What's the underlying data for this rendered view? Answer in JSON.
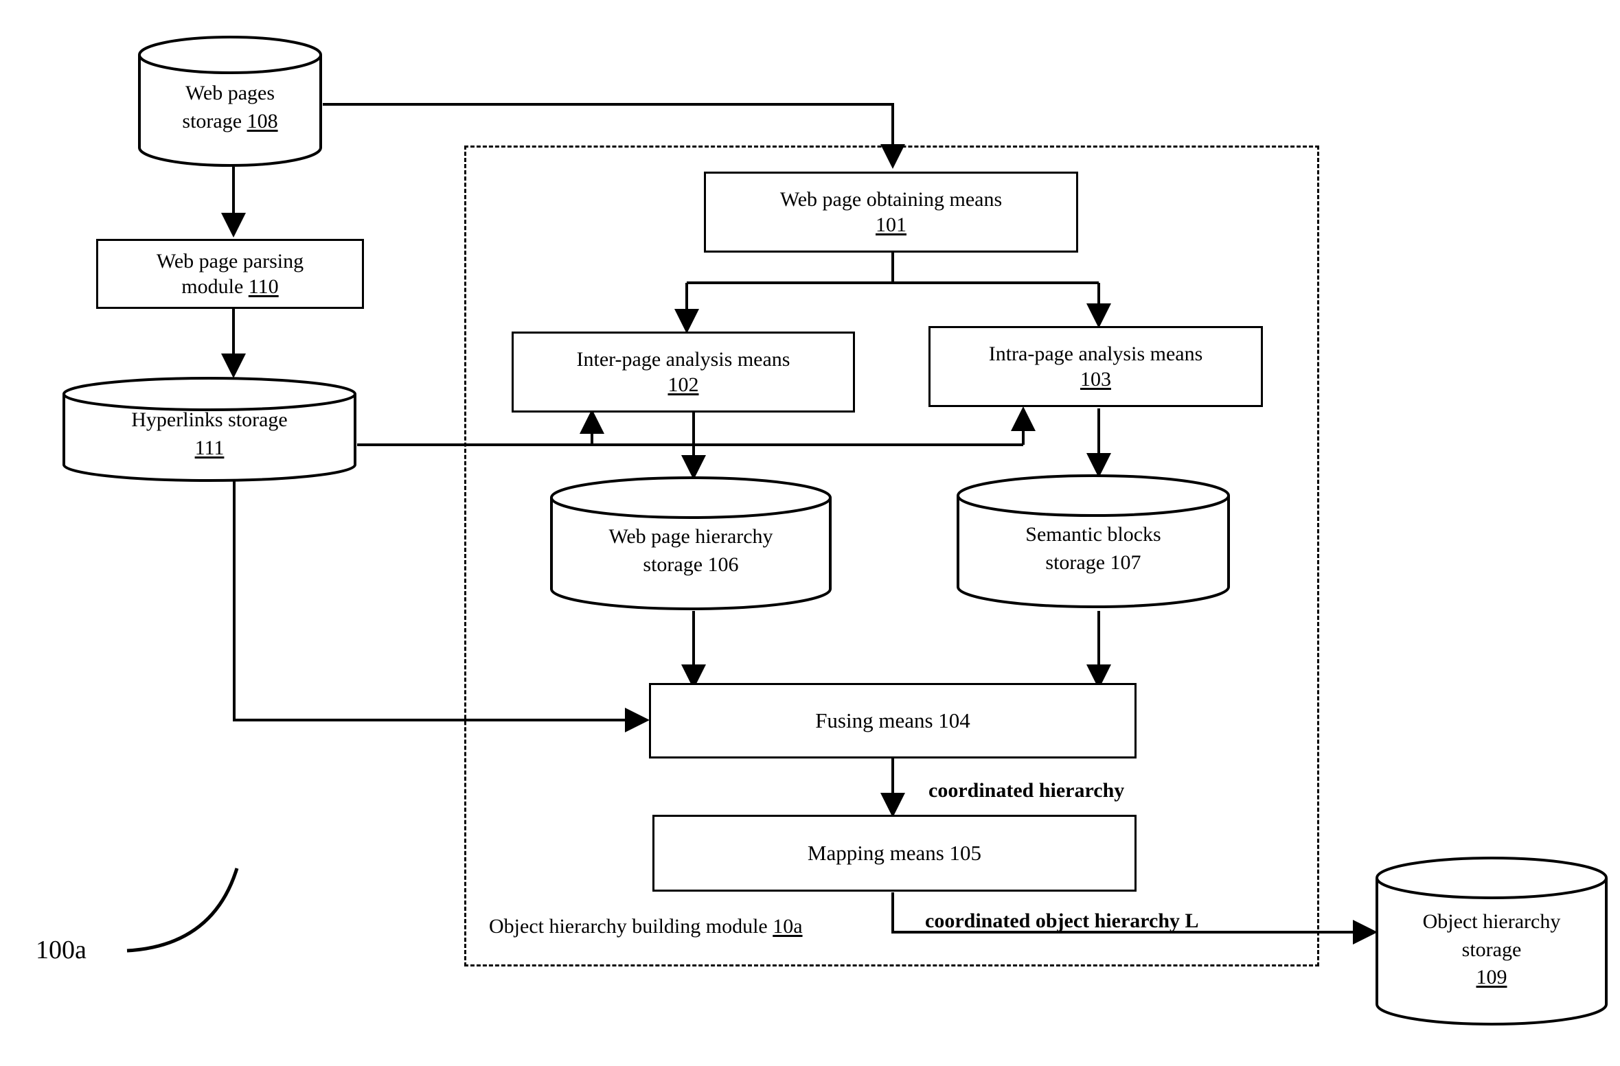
{
  "figure": {
    "label": "100a",
    "module_box": {
      "caption_prefix": "Object hierarchy building module ",
      "caption_ref": "10a"
    }
  },
  "nodes": {
    "web_pages_storage": {
      "line1": "Web pages",
      "line2_prefix": "storage ",
      "line2_ref": "108"
    },
    "web_page_parsing_module": {
      "line1": "Web page parsing",
      "line2_prefix": "module ",
      "line2_ref": "110"
    },
    "hyperlinks_storage": {
      "line1": "Hyperlinks storage",
      "line2_ref": "111"
    },
    "web_page_obtaining_means": {
      "line1": "Web page obtaining means",
      "line2_ref": "101"
    },
    "inter_page_analysis_means": {
      "line1": "Inter-page analysis means",
      "line2_ref": "102"
    },
    "intra_page_analysis_means": {
      "line1": "Intra-page analysis means",
      "line2_ref": "103"
    },
    "web_page_hierarchy_storage": {
      "line1": "Web page hierarchy",
      "line2": "storage 106"
    },
    "semantic_blocks_storage": {
      "line1": "Semantic blocks",
      "line2": "storage 107"
    },
    "fusing_means": {
      "label": "Fusing means 104"
    },
    "mapping_means": {
      "label": "Mapping means 105"
    },
    "object_hierarchy_storage": {
      "line1": "Object hierarchy",
      "line2": "storage",
      "line3_ref": "109"
    }
  },
  "edge_labels": {
    "coordinated_hierarchy": "coordinated hierarchy",
    "coordinated_object_hierarchy": "coordinated object hierarchy L"
  },
  "colors": {
    "stroke": "#000000",
    "background": "#ffffff"
  }
}
